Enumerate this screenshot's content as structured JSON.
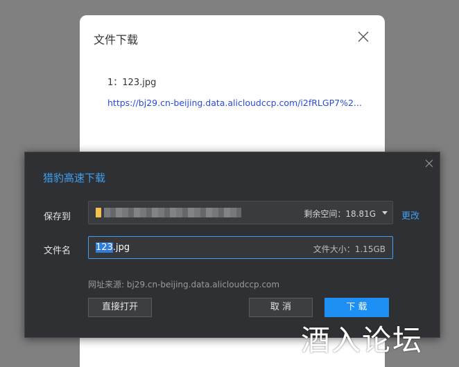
{
  "file_dialog": {
    "title": "文件下载",
    "item_line": "1：123.jpg",
    "url": "https://bj29.cn-beijing.data.alicloudccp.com/i2fRLGP7%2..."
  },
  "download_panel": {
    "title": "猎豹高速下载",
    "save_to_label": "保存到",
    "free_space": "剩余空间：18.81G",
    "change_label": "更改",
    "filename_label": "文件名",
    "filename_selected": "123",
    "filename_rest": ".jpg",
    "file_size": "文件大小：1.15GB",
    "source": "网址来源: bj29.cn-beijing.data.alicloudccp.com",
    "open_button": "直接打开",
    "cancel_button": "取 消",
    "download_button": "下 载"
  },
  "watermark": "酒入论坛",
  "colors": {
    "accent": "#1e8ff3",
    "title_blue": "#3ea0f2",
    "link": "#2a4ad8",
    "panel_bg": "#2f3033",
    "backdrop": "#808080"
  }
}
